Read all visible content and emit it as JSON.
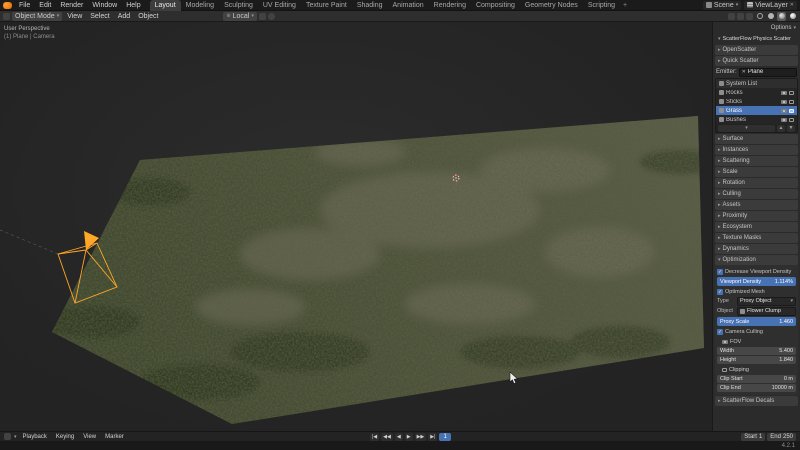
{
  "icons": {
    "caret_down": "▾",
    "caret_right": "▸",
    "check": "✓",
    "close": "✕",
    "plus": "+",
    "globe": "⊕",
    "jump_start": "|◀",
    "prev_key": "◀◀",
    "play_back": "◀",
    "play": "▶",
    "next_key": "▶▶",
    "jump_end": "▶|",
    "move_up": "▲",
    "move_down": "▼"
  },
  "topbar": {
    "menus": [
      "File",
      "Edit",
      "Render",
      "Window",
      "Help"
    ],
    "workspaces": [
      "Layout",
      "Modeling",
      "Sculpting",
      "UV Editing",
      "Texture Paint",
      "Shading",
      "Animation",
      "Rendering",
      "Compositing",
      "Geometry Nodes",
      "Scripting"
    ],
    "active_workspace": "Layout",
    "scene_label": "Scene",
    "view_layer_label": "ViewLayer"
  },
  "viewport_header": {
    "mode": "Object Mode",
    "menus": [
      "View",
      "Select",
      "Add",
      "Object"
    ],
    "orientation": "Local"
  },
  "viewport": {
    "overlay_line1": "User Perspective",
    "overlay_line2": "(1) Plane | Camera"
  },
  "sidebar": {
    "options_label": "Options",
    "panel_title": "ScatterFlow Physics Scatter",
    "panel_openscatter": "OpenScatter",
    "panel_quick_scatter": "Quick Scatter",
    "emitter_label": "Emitter:",
    "emitter_value": "Plane",
    "system_list_label": "System List",
    "systems": [
      {
        "name": "Rocks"
      },
      {
        "name": "Sticks"
      },
      {
        "name": "Grass"
      },
      {
        "name": "Bushes"
      }
    ],
    "selected_system": "Grass",
    "sections": [
      "Surface",
      "Instances",
      "Scattering",
      "Scale",
      "Rotation",
      "Culling",
      "Assets",
      "Proximity",
      "Ecosystem",
      "Texture Masks",
      "Dynamics"
    ],
    "optimization": {
      "title": "Optimization",
      "decrease_label": "Decrease Viewport Density",
      "viewport_density_label": "Viewport Density",
      "viewport_density_value": "1.114%",
      "optimized_mesh_label": "Optimized Mesh",
      "type_label": "Type",
      "type_value": "Proxy Object",
      "object_label": "Object",
      "object_value": "Flower Clump",
      "proxy_scale_label": "Proxy Scale",
      "proxy_scale_value": "1.460",
      "camera_culling_label": "Camera Culling",
      "fov_label": "FOV",
      "width_label": "Width",
      "width_value": "5.400",
      "height_label": "Height",
      "height_value": "1.840",
      "clipping_label": "Clipping",
      "clip_start_label": "Clip Start",
      "clip_start_value": "0 m",
      "clip_end_label": "Clip End",
      "clip_end_value": "10000 m"
    },
    "decals_title": "ScatterFlow Decals"
  },
  "timeline": {
    "menus": [
      "Playback",
      "Keying",
      "View",
      "Marker"
    ],
    "frame_current": "1",
    "start_label": "Start",
    "start_value": "1",
    "end_label": "End",
    "end_value": "250"
  },
  "statusbar": {
    "version": "4.2.1"
  },
  "colors": {
    "accent_blue": "#4772b3",
    "camera_orange": "#ffa726",
    "header_bg": "#2e2e2e",
    "viewport_bg": "#242424"
  }
}
